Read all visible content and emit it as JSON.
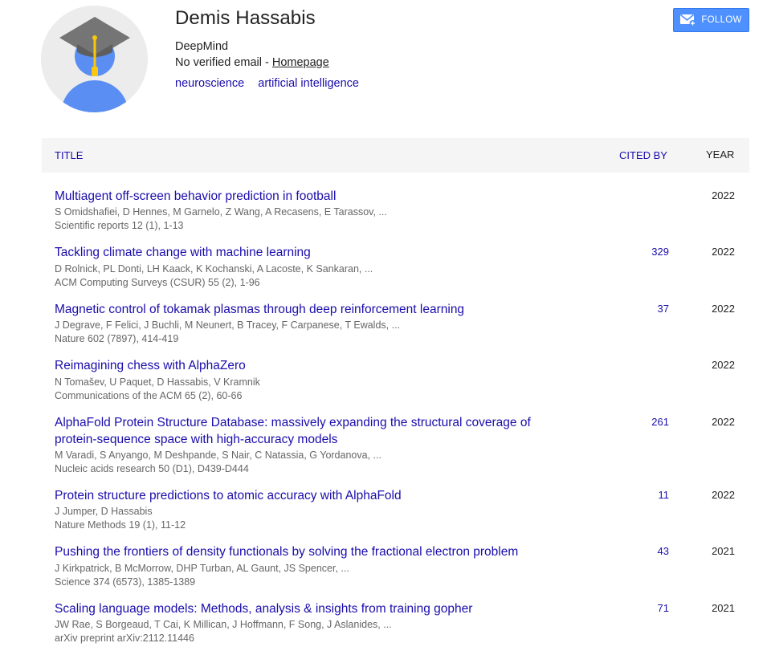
{
  "profile": {
    "name": "Demis Hassabis",
    "affiliation": "DeepMind",
    "email_text": "No verified email - ",
    "homepage_label": "Homepage",
    "interests": [
      "neuroscience",
      "artificial intelligence"
    ]
  },
  "follow": {
    "label": "FOLLOW",
    "icon": "email-plus-icon"
  },
  "table": {
    "col_title": "TITLE",
    "col_cited": "CITED BY",
    "col_year": "YEAR"
  },
  "colors": {
    "link": "#1a0dab",
    "button": "#4d90fe",
    "header_bg": "#f5f5f5",
    "secondary_text": "#666666"
  },
  "articles": [
    {
      "title": "Multiagent off-screen behavior prediction in football",
      "authors": "S Omidshafiei, D Hennes, M Garnelo, Z Wang, A Recasens, E Tarassov, ...",
      "venue": "Scientific reports 12 (1), 1-13",
      "cited": "",
      "year": "2022"
    },
    {
      "title": "Tackling climate change with machine learning",
      "authors": "D Rolnick, PL Donti, LH Kaack, K Kochanski, A Lacoste, K Sankaran, ...",
      "venue": "ACM Computing Surveys (CSUR) 55 (2), 1-96",
      "cited": "329",
      "year": "2022"
    },
    {
      "title": "Magnetic control of tokamak plasmas through deep reinforcement learning",
      "authors": "J Degrave, F Felici, J Buchli, M Neunert, B Tracey, F Carpanese, T Ewalds, ...",
      "venue": "Nature 602 (7897), 414-419",
      "cited": "37",
      "year": "2022"
    },
    {
      "title": "Reimagining chess with AlphaZero",
      "authors": "N Tomašev, U Paquet, D Hassabis, V Kramnik",
      "venue": "Communications of the ACM 65 (2), 60-66",
      "cited": "",
      "year": "2022"
    },
    {
      "title": "AlphaFold Protein Structure Database: massively expanding the structural coverage of protein-sequence space with high-accuracy models",
      "authors": "M Varadi, S Anyango, M Deshpande, S Nair, C Natassia, G Yordanova, ...",
      "venue": "Nucleic acids research 50 (D1), D439-D444",
      "cited": "261",
      "year": "2022"
    },
    {
      "title": "Protein structure predictions to atomic accuracy with AlphaFold",
      "authors": "J Jumper, D Hassabis",
      "venue": "Nature Methods 19 (1), 11-12",
      "cited": "11",
      "year": "2022"
    },
    {
      "title": "Pushing the frontiers of density functionals by solving the fractional electron problem",
      "authors": "J Kirkpatrick, B McMorrow, DHP Turban, AL Gaunt, JS Spencer, ...",
      "venue": "Science 374 (6573), 1385-1389",
      "cited": "43",
      "year": "2021"
    },
    {
      "title": "Scaling language models: Methods, analysis & insights from training gopher",
      "authors": "JW Rae, S Borgeaud, T Cai, K Millican, J Hoffmann, F Song, J Aslanides, ...",
      "venue": "arXiv preprint arXiv:2112.11446",
      "cited": "71",
      "year": "2021"
    }
  ]
}
